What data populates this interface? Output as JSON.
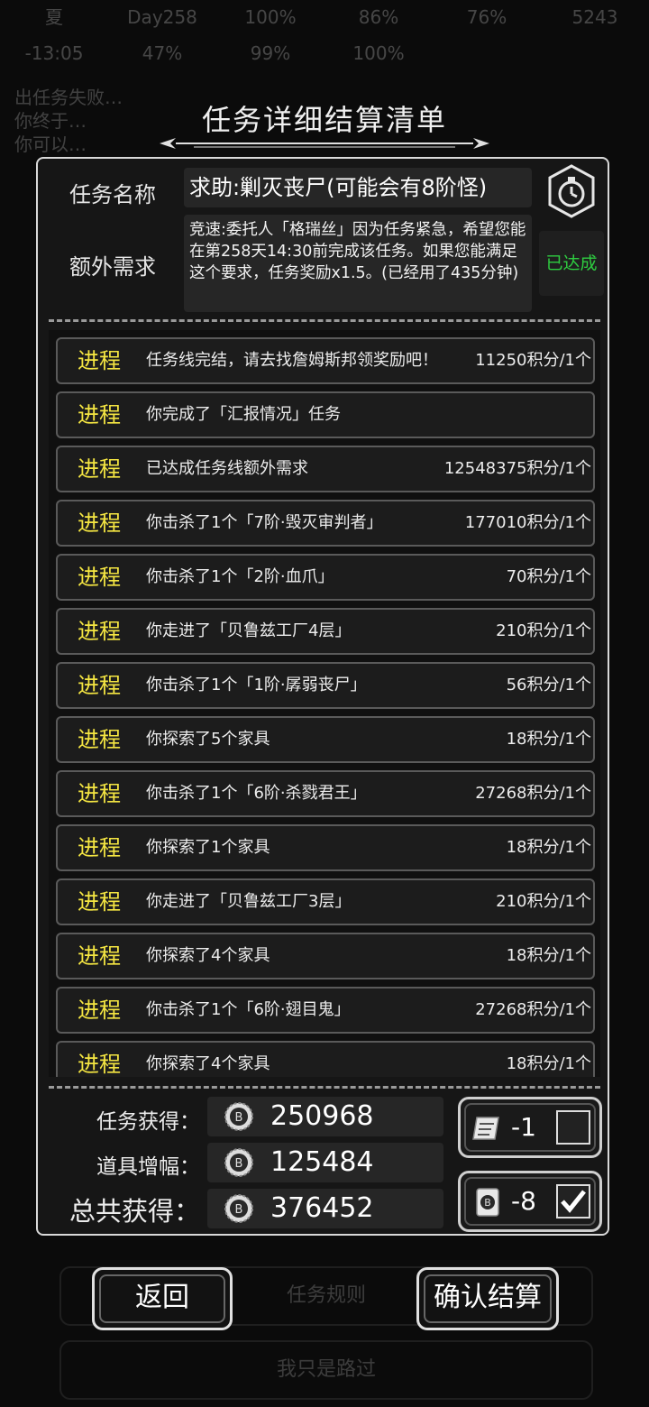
{
  "background": {
    "stats": [
      "夏",
      "Day258",
      "100%",
      "86%",
      "76%",
      "5243",
      "-13:05",
      "47%",
      "99%",
      "100%"
    ],
    "log_lines": [
      "出任务失败…",
      "你终于…",
      "你可以…"
    ],
    "buttons": {
      "rules": "任务规则",
      "passing": "我只是路过"
    }
  },
  "title": "任务详细结算清单",
  "mission": {
    "name_label": "任务名称",
    "name": "求助:剿灭丧尸(可能会有8阶怪)",
    "extra_label": "额外需求",
    "extra_text": "竞速:委托人「格瑞丝」因为任务紧急，希望您能在第258天14:30前完成该任务。如果您能满足这个要求，任务奖励x1.5。(已经用了435分钟)",
    "extra_status": "已达成",
    "extra_status_color": "#2ecc40"
  },
  "rows": [
    {
      "tag": "进程",
      "text": "任务线完结，请去找詹姆斯邦领奖励吧！",
      "points": "11250积分/1个"
    },
    {
      "tag": "进程",
      "text": "你完成了「汇报情况」任务",
      "points": ""
    },
    {
      "tag": "进程",
      "text": "已达成任务线额外需求",
      "points": "12548375积分/1个"
    },
    {
      "tag": "进程",
      "text": "你击杀了1个「7阶·毁灭审判者」",
      "points": "177010积分/1个"
    },
    {
      "tag": "进程",
      "text": "你击杀了1个「2阶·血爪」",
      "points": "70积分/1个"
    },
    {
      "tag": "进程",
      "text": "你走进了「贝鲁兹工厂4层」",
      "points": "210积分/1个"
    },
    {
      "tag": "进程",
      "text": "你击杀了1个「1阶·孱弱丧尸」",
      "points": "56积分/1个"
    },
    {
      "tag": "进程",
      "text": "你探索了5个家具",
      "points": "18积分/1个"
    },
    {
      "tag": "进程",
      "text": "你击杀了1个「6阶·杀戮君王」",
      "points": "27268积分/1个"
    },
    {
      "tag": "进程",
      "text": "你探索了1个家具",
      "points": "18积分/1个"
    },
    {
      "tag": "进程",
      "text": "你走进了「贝鲁兹工厂3层」",
      "points": "210积分/1个"
    },
    {
      "tag": "进程",
      "text": "你探索了4个家具",
      "points": "18积分/1个"
    },
    {
      "tag": "进程",
      "text": "你击杀了1个「6阶·翅目鬼」",
      "points": "27268积分/1个"
    },
    {
      "tag": "进程",
      "text": "你探索了4个家具",
      "points": "18积分/1个"
    }
  ],
  "summary": {
    "mission_label": "任务获得：",
    "mission_value": "250968",
    "item_label": "道具增幅：",
    "item_value": "125484",
    "total_label": "总共获得：",
    "total_value": "376452"
  },
  "items": [
    {
      "icon": "scroll-icon",
      "count": "-1",
      "checked": false
    },
    {
      "icon": "card-icon",
      "count": "-8",
      "checked": true
    }
  ],
  "actions": {
    "back": "返回",
    "confirm": "确认结算"
  },
  "colors": {
    "tag": "#f5e642",
    "panel_border": "#d9d9d9"
  }
}
